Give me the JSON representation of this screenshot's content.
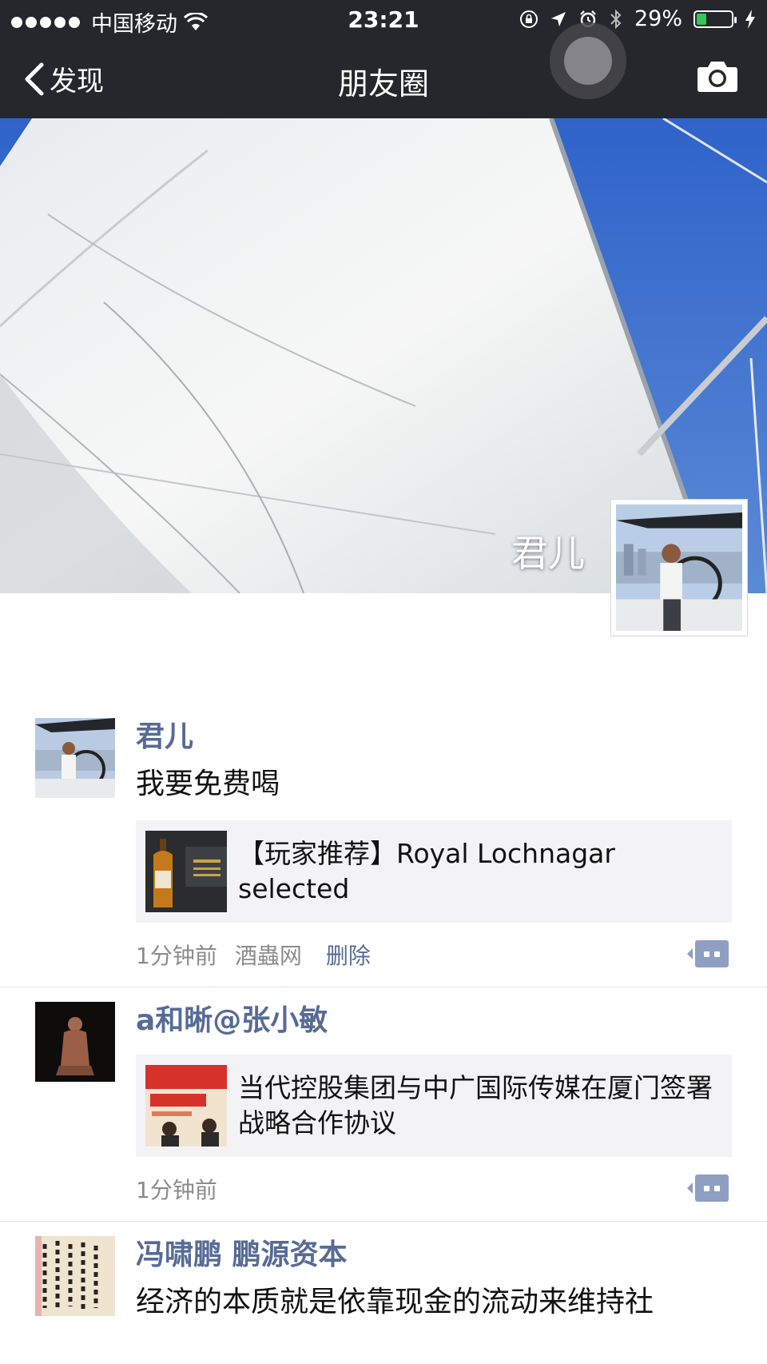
{
  "status_bar": {
    "carrier": "中国移动",
    "time": "23:21",
    "battery": "29%",
    "battery_level": 0.29
  },
  "nav": {
    "back_label": "发现",
    "title": "朋友圈"
  },
  "cover": {
    "owner_name": "君儿"
  },
  "posts": [
    {
      "name": "君儿",
      "text": "我要免费喝",
      "share_title": "【玩家推荐】Royal Lochnagar selected",
      "time": "1分钟前",
      "source": "酒蟲网",
      "delete_label": "删除"
    },
    {
      "name": "a和晰@张小敏",
      "share_title": "当代控股集团与中广国际传媒在厦门签署战略合作协议",
      "time": "1分钟前"
    },
    {
      "name": "冯啸鹏 鹏源资本",
      "text": "经济的本质就是依靠现金的流动来维持社"
    }
  ],
  "colors": {
    "nav_bg": "#26272c",
    "name_link": "#576b95",
    "share_bg": "#f3f3f5",
    "comment_button": "#8e9fc3",
    "battery_fill": "#34c759"
  },
  "icons": [
    "wifi-icon",
    "orientation-lock-icon",
    "location-arrow-icon",
    "alarm-icon",
    "bluetooth-icon",
    "charging-bolt-icon",
    "chevron-left-icon",
    "camera-icon",
    "comment-icon"
  ]
}
